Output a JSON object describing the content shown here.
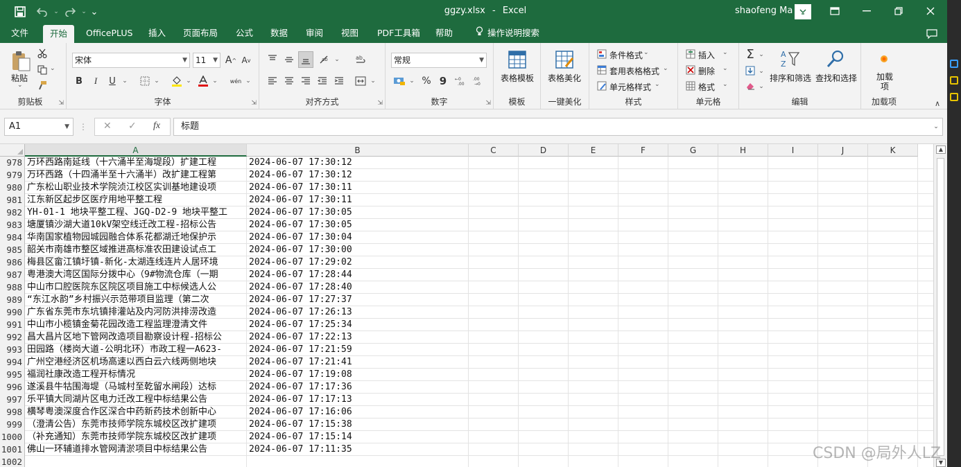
{
  "app": {
    "filename": "ggzy.xlsx",
    "separator": "-",
    "app_name": "Excel",
    "user": "shaofeng Ma"
  },
  "quick_access": {
    "save_icon": "save-icon",
    "undo_icon": "undo-icon",
    "redo_icon": "redo-icon",
    "more": "⌄"
  },
  "menu_tabs": [
    "文件",
    "开始",
    "OfficePLUS",
    "插入",
    "页面布局",
    "公式",
    "数据",
    "审阅",
    "视图",
    "PDF工具箱",
    "帮助",
    "操作说明搜索"
  ],
  "active_tab": "开始",
  "ribbon": {
    "clipboard": {
      "label": "剪贴板",
      "paste": "粘贴"
    },
    "font": {
      "label": "字体",
      "name": "宋体",
      "size": "11",
      "bold": "B",
      "italic": "I",
      "underline": "U",
      "grow": "A",
      "shrink": "A",
      "phonetic": "wén"
    },
    "alignment": {
      "label": "对齐方式"
    },
    "number": {
      "label": "数字",
      "format": "常规",
      "percent": "%",
      "comma": "9"
    },
    "template": {
      "label": "模板",
      "button": "表格模板"
    },
    "beautify": {
      "label": "一键美化",
      "button": "表格美化"
    },
    "styles": {
      "label": "样式",
      "conditional": "条件格式",
      "table_style": "套用表格格式",
      "cell_style": "单元格样式"
    },
    "cells": {
      "label": "单元格",
      "insert": "插入",
      "delete": "删除",
      "format": "格式"
    },
    "editing": {
      "label": "编辑",
      "sort": "排序和筛选",
      "find": "查找和选择",
      "sigma": "Σ"
    },
    "addins": {
      "label": "加载项",
      "button": "加载项"
    }
  },
  "formula_bar": {
    "name_box": "A1",
    "cancel": "✕",
    "enter": "✓",
    "fx": "fx",
    "content": "标题"
  },
  "columns": [
    "A",
    "B",
    "C",
    "D",
    "E",
    "F",
    "G",
    "H",
    "I",
    "J",
    "K"
  ],
  "rows": [
    {
      "num": "978",
      "a": "万环西路南延线（十六涌半至海堤段）扩建工程",
      "b": "2024-06-07 17:30:12"
    },
    {
      "num": "979",
      "a": "万环西路（十四涌半至十六涌半）改扩建工程第",
      "b": "2024-06-07 17:30:12"
    },
    {
      "num": "980",
      "a": "广东松山职业技术学院浈江校区实训基地建设项",
      "b": "2024-06-07 17:30:11"
    },
    {
      "num": "981",
      "a": "江东新区起步区医疗用地平整工程",
      "b": "2024-06-07 17:30:11"
    },
    {
      "num": "982",
      "a": "YH-01-1 地块平整工程、JGQ-D2-9 地块平整工",
      "b": "2024-06-07 17:30:05"
    },
    {
      "num": "983",
      "a": "塘厦镇沙湖大道10kV架空线迁改工程-招标公告",
      "b": "2024-06-07 17:30:05"
    },
    {
      "num": "984",
      "a": "华南国家植物园城园融合体系花都湖迁地保护示",
      "b": "2024-06-07 17:30:04"
    },
    {
      "num": "985",
      "a": "韶关市南雄市整区域推进高标准农田建设试点工",
      "b": "2024-06-07 17:30:00"
    },
    {
      "num": "986",
      "a": "梅县区畲江镇圩镇-新化-太湖连线连片人居环境",
      "b": "2024-06-07 17:29:02"
    },
    {
      "num": "987",
      "a": "粤港澳大湾区国际分拨中心（9#物流仓库（一期",
      "b": "2024-06-07 17:28:44"
    },
    {
      "num": "988",
      "a": "中山市口腔医院东区院区项目施工中标候选人公",
      "b": "2024-06-07 17:28:40"
    },
    {
      "num": "989",
      "a": "“东江水韵”乡村振兴示范带项目监理（第二次",
      "b": "2024-06-07 17:27:37"
    },
    {
      "num": "990",
      "a": "广东省东莞市东坑镇排灌站及内河防洪排涝改造",
      "b": "2024-06-07 17:26:13"
    },
    {
      "num": "991",
      "a": "中山市小榄镇金菊花园改造工程监理澄清文件",
      "b": "2024-06-07 17:25:34"
    },
    {
      "num": "992",
      "a": "昌大昌片区地下管网改造项目勘察设计程-招标公",
      "b": "2024-06-07 17:22:13"
    },
    {
      "num": "993",
      "a": "田园路（楼岗大道-公明北环）市政工程一A623-",
      "b": "2024-06-07 17:21:59"
    },
    {
      "num": "994",
      "a": "广州空港经济区机场高速以西白云六线两侧地块",
      "b": "2024-06-07 17:21:41"
    },
    {
      "num": "995",
      "a": "福润社康改造工程开标情况",
      "b": "2024-06-07 17:19:08"
    },
    {
      "num": "996",
      "a": "遂溪县牛牯围海堤（马城村至乾留水闸段）达标",
      "b": "2024-06-07 17:17:36"
    },
    {
      "num": "997",
      "a": "乐平镇大同湖片区电力迁改工程中标结果公告",
      "b": "2024-06-07 17:17:13"
    },
    {
      "num": "998",
      "a": "横琴粤澳深度合作区深合中药新药技术创新中心",
      "b": "2024-06-07 17:16:06"
    },
    {
      "num": "999",
      "a": "（澄清公告）东莞市技师学院东城校区改扩建项",
      "b": "2024-06-07 17:15:38"
    },
    {
      "num": "1000",
      "a": "（补充通知）东莞市技师学院东城校区改扩建项",
      "b": "2024-06-07 17:15:14"
    },
    {
      "num": "1001",
      "a": "佛山一环辅道排水管网清淤项目中标结果公告",
      "b": "2024-06-07 17:11:35"
    },
    {
      "num": "1002",
      "a": "",
      "b": ""
    }
  ],
  "watermark": "CSDN @局外人LZ",
  "colors": {
    "brand": "#1e6b3e",
    "ribbon_bg": "#f3f3f3",
    "grid_line": "#e3e3e3"
  }
}
